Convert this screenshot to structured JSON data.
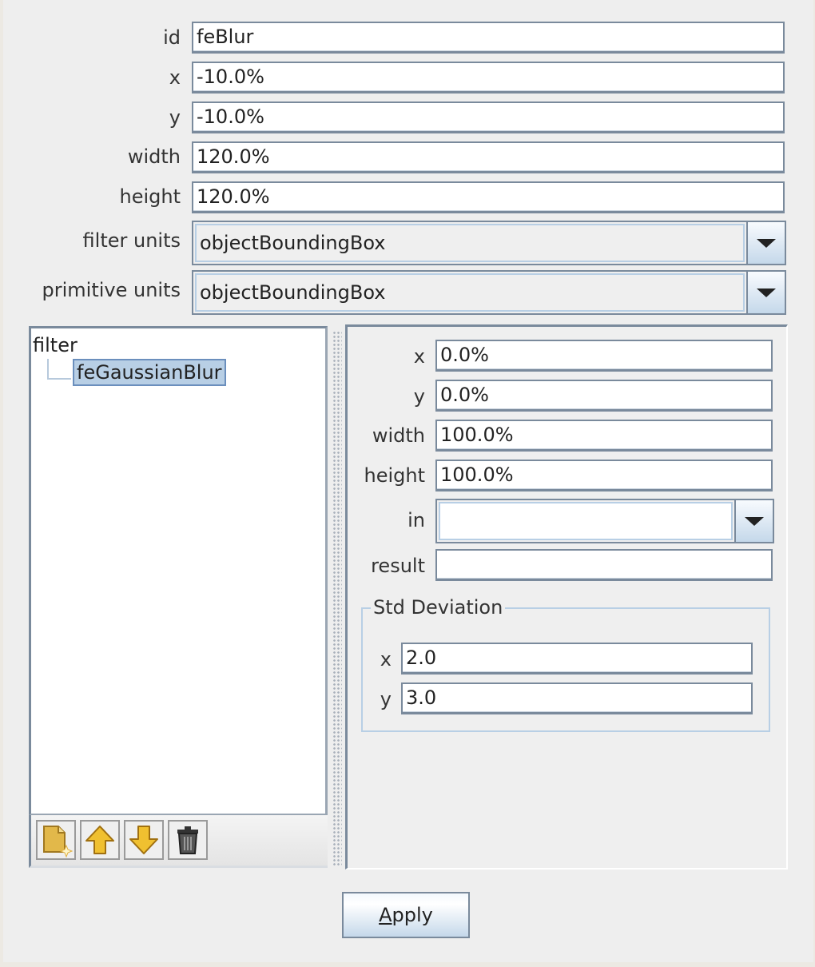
{
  "filter_form": {
    "fields": [
      {
        "label": "id",
        "value": "feBlur"
      },
      {
        "label": "x",
        "value": "-10.0%"
      },
      {
        "label": "y",
        "value": "-10.0%"
      },
      {
        "label": "width",
        "value": "120.0%"
      },
      {
        "label": "height",
        "value": "120.0%"
      }
    ],
    "filter_units": {
      "label": "filter units",
      "value": "objectBoundingBox"
    },
    "primitive_units": {
      "label": "primitive units",
      "value": "objectBoundingBox"
    }
  },
  "tree": {
    "root": "filter",
    "children": [
      "feGaussianBlur"
    ],
    "selected": "feGaussianBlur",
    "toolbar": [
      {
        "name": "new-primitive",
        "icon": "new-document-icon"
      },
      {
        "name": "move-up",
        "icon": "arrow-up-icon"
      },
      {
        "name": "move-down",
        "icon": "arrow-down-icon"
      },
      {
        "name": "delete",
        "icon": "trash-icon"
      }
    ]
  },
  "primitive_form": {
    "fields": [
      {
        "label": "x",
        "value": "0.0%"
      },
      {
        "label": "y",
        "value": "0.0%"
      },
      {
        "label": "width",
        "value": "100.0%"
      },
      {
        "label": "height",
        "value": "100.0%"
      }
    ],
    "in": {
      "label": "in",
      "value": ""
    },
    "result": {
      "label": "result",
      "value": ""
    },
    "std_deviation": {
      "title": "Std Deviation",
      "x": {
        "label": "x",
        "value": "2.0"
      },
      "y": {
        "label": "y",
        "value": "3.0"
      }
    }
  },
  "apply_button": {
    "mnemonic": "A",
    "rest": "pply"
  }
}
